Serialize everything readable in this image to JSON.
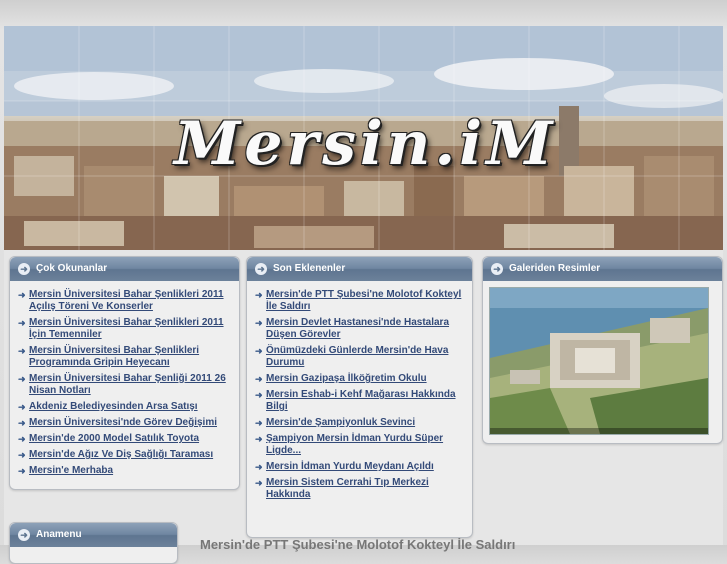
{
  "site": {
    "logo_text": "Mersin.iM"
  },
  "boxes": {
    "cok_okunanlar": {
      "title": "Çok Okunanlar",
      "items": [
        "Mersin Üniversitesi Bahar Şenlikleri 2011 Açılış Töreni Ve Konserler",
        "Mersin Üniversitesi Bahar Şenlikleri 2011 İçin Temenniler",
        "Mersin Üniversitesi Bahar Şenlikleri Programında Gripin Heyecanı",
        "Mersin Üniversitesi Bahar Şenliği 2011 26 Nisan Notları",
        "Akdeniz Belediyesinden Arsa Satışı",
        "Mersin Üniversitesi'nde Görev Değişimi",
        "Mersin'de 2000 Model Satılık Toyota",
        "Mersin'de Ağız Ve Diş Sağlığı Taraması",
        "Mersin'e Merhaba"
      ]
    },
    "son_eklenenler": {
      "title": "Son Eklenenler",
      "items": [
        "Mersin'de PTT Şubesi'ne Molotof Kokteyl İle Saldırı",
        "Mersin Devlet Hastanesi'nde Hastalara Düşen Görevler",
        "Önümüzdeki Günlerde Mersin'de Hava Durumu",
        "Mersin Gazipaşa İlköğretim Okulu",
        "Mersin Eshab-i Kehf Mağarası Hakkında Bilgi",
        "Mersin'de Şampiyonluk Sevinci",
        "Şampiyon Mersin İdman Yurdu Süper Ligde...",
        "Mersin İdman Yurdu Meydanı Açıldı",
        "Mersin Sistem Cerrahi Tıp Merkezi Hakkında"
      ]
    },
    "galeri": {
      "title": "Galeriden Resimler"
    },
    "anamenu": {
      "title": "Anamenu"
    }
  },
  "main": {
    "article_title": "Mersin'de PTT Şubesi'ne Molotof Kokteyl İle Saldırı"
  },
  "colors": {
    "header_bar": "#6f86a1",
    "link": "#334a78",
    "box_bg": "#efefef"
  }
}
